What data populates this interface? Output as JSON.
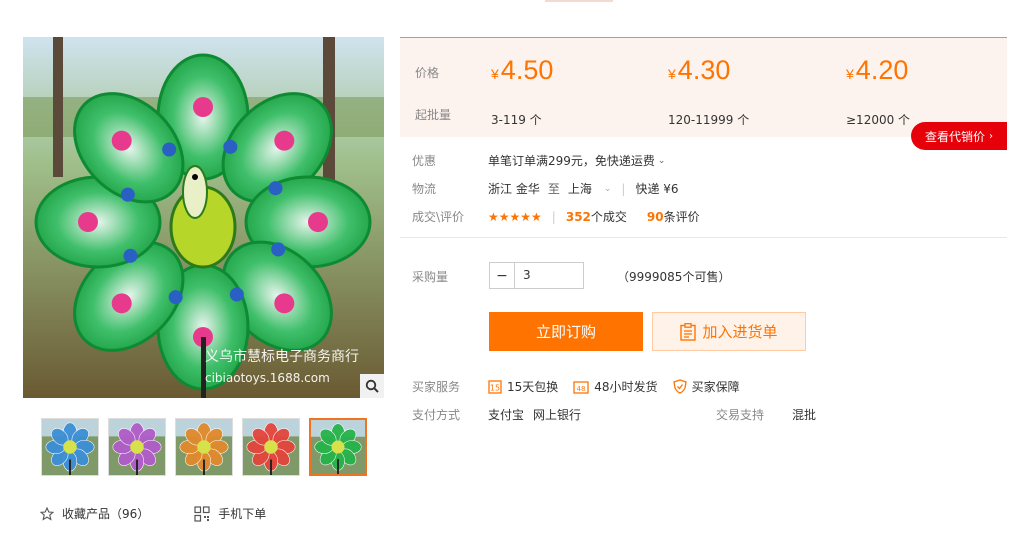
{
  "gallery": {
    "watermark_line1": "义乌市慧标电子商务商行",
    "watermark_line2": "cibiaotoys.1688.com",
    "zoom_icon": "magnifier-icon",
    "thumbnail_colors": [
      "#3c8fd6",
      "#b05cc8",
      "#e08a2c",
      "#e4453c",
      "#27b34a"
    ],
    "active_thumbnail": 5,
    "favorite_label": "收藏产品（96）",
    "favorite_icon": "star-outline-icon",
    "mobile_order_label": "手机下单",
    "mobile_order_icon": "qrcode-icon"
  },
  "pricing": {
    "price_label": "价格",
    "qty_label": "起批量",
    "tiers": [
      {
        "currency": "¥",
        "price": "4.50",
        "range": "3-119 个"
      },
      {
        "currency": "¥",
        "price": "4.30",
        "range": "120-11999 个"
      },
      {
        "currency": "¥",
        "price": "4.20",
        "range": "≥12000 个"
      }
    ],
    "agent_price_button": "查看代销价",
    "accent_color": "#ff7300"
  },
  "info": {
    "promo_label": "优惠",
    "promo_text": "单笔订单满299元，免快递运费",
    "logistics_label": "物流",
    "from": "浙江 金华",
    "to_word": "至",
    "to": "上海",
    "express": "快递 ¥6",
    "rating_label": "成交\\评价",
    "rating_stars": 4.5,
    "stars_glyphs": "★★★★★",
    "deals_count": "352",
    "deals_suffix": "个成交",
    "reviews_count": "90",
    "reviews_suffix": "条评价"
  },
  "purchase": {
    "qty_label": "采购量",
    "minus": "−",
    "qty_value": "3",
    "stock": "（9999085个可售）",
    "buy_button": "立即订购",
    "cart_button": "加入进货单"
  },
  "services": {
    "label": "买家服务",
    "items": [
      {
        "icon": "return-15day-icon",
        "text": "15天包换"
      },
      {
        "icon": "ship-48h-icon",
        "text": "48小时发货"
      },
      {
        "icon": "shield-icon",
        "text": "买家保障"
      }
    ],
    "payment_label": "支付方式",
    "payment_methods": [
      "支付宝",
      "网上银行"
    ],
    "trade_label": "交易支持",
    "trade_value": "混批"
  }
}
